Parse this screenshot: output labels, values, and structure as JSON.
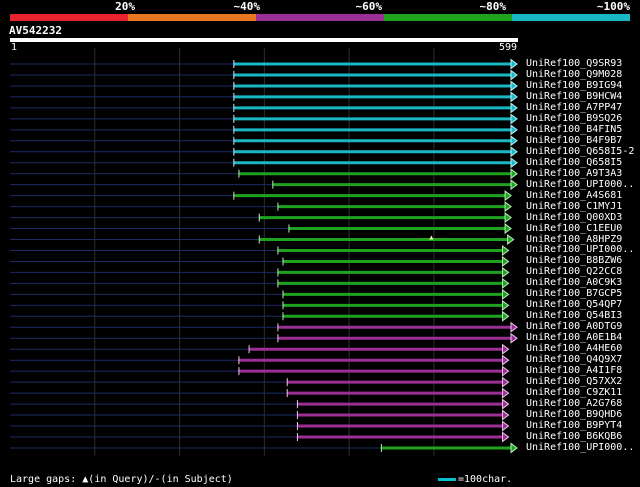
{
  "scale": {
    "segments": [
      {
        "label": "20%",
        "color": "#e8232f"
      },
      {
        "label": "~40%",
        "color": "#e87722"
      },
      {
        "label": "~60%",
        "color": "#9b2f96"
      },
      {
        "label": "~80%",
        "color": "#1fa31f"
      },
      {
        "label": "~100%",
        "color": "#1ab7c4"
      }
    ]
  },
  "query": {
    "name": "AV542232",
    "start": "1",
    "end": "599",
    "length": 599
  },
  "colors": {
    "cyan": "#1ab7c4",
    "green": "#1fa31f",
    "purple": "#9b2f96",
    "dotted": "#1c2a66",
    "gridline": "#2e2e2e",
    "arrow_cyan": "#bdf2f6",
    "arrow_green": "#b8f0b8",
    "arrow_purple": "#f0c6ee"
  },
  "hits": [
    {
      "label": "UniRef100_Q9SR93",
      "color": "cyan",
      "start": 265,
      "end": 599
    },
    {
      "label": "UniRef100_Q9M028",
      "color": "cyan",
      "start": 265,
      "end": 599
    },
    {
      "label": "UniRef100_B9IG94",
      "color": "cyan",
      "start": 265,
      "end": 599
    },
    {
      "label": "UniRef100_B9HCW4",
      "color": "cyan",
      "start": 265,
      "end": 599
    },
    {
      "label": "UniRef100_A7PP47",
      "color": "cyan",
      "start": 265,
      "end": 599
    },
    {
      "label": "UniRef100_B9SQ26",
      "color": "cyan",
      "start": 265,
      "end": 599
    },
    {
      "label": "UniRef100_B4FIN5",
      "color": "cyan",
      "start": 265,
      "end": 599
    },
    {
      "label": "UniRef100_B4F9B7",
      "color": "cyan",
      "start": 265,
      "end": 599
    },
    {
      "label": "UniRef100_Q658I5-2",
      "color": "cyan",
      "start": 265,
      "end": 599
    },
    {
      "label": "UniRef100_Q658I5",
      "color": "cyan",
      "start": 265,
      "end": 599
    },
    {
      "label": "UniRef100_A9T3A3",
      "color": "green",
      "start": 271,
      "end": 599
    },
    {
      "label": "UniRef100_UPI000..",
      "color": "green",
      "start": 311,
      "end": 599
    },
    {
      "label": "UniRef100_A4S681",
      "color": "green",
      "start": 265,
      "end": 592
    },
    {
      "label": "UniRef100_C1MYJ1",
      "color": "green",
      "start": 317,
      "end": 592
    },
    {
      "label": "UniRef100_Q00XD3",
      "color": "green",
      "start": 295,
      "end": 592
    },
    {
      "label": "UniRef100_C1EEU0",
      "color": "green",
      "start": 330,
      "end": 592
    },
    {
      "label": "UniRef100_A8HPZ9",
      "color": "green",
      "start": 295,
      "end": 595,
      "gap_at": 498
    },
    {
      "label": "UniRef100_UPI000..",
      "color": "green",
      "start": 317,
      "end": 589
    },
    {
      "label": "UniRef100_B8BZW6",
      "color": "green",
      "start": 323,
      "end": 589
    },
    {
      "label": "UniRef100_Q22CC8",
      "color": "green",
      "start": 317,
      "end": 589
    },
    {
      "label": "UniRef100_A0C9K3",
      "color": "green",
      "start": 317,
      "end": 589
    },
    {
      "label": "UniRef100_B7GCP5",
      "color": "green",
      "start": 323,
      "end": 589
    },
    {
      "label": "UniRef100_Q54QP7",
      "color": "green",
      "start": 323,
      "end": 589
    },
    {
      "label": "UniRef100_Q54BI3",
      "color": "green",
      "start": 323,
      "end": 589
    },
    {
      "label": "UniRef100_A0DTG9",
      "color": "purple",
      "start": 317,
      "end": 599
    },
    {
      "label": "UniRef100_A0E1B4",
      "color": "purple",
      "start": 317,
      "end": 599
    },
    {
      "label": "UniRef100_A4HE60",
      "color": "purple",
      "start": 283,
      "end": 589
    },
    {
      "label": "UniRef100_Q4Q9X7",
      "color": "purple",
      "start": 271,
      "end": 589
    },
    {
      "label": "UniRef100_A4I1F8",
      "color": "purple",
      "start": 271,
      "end": 589
    },
    {
      "label": "UniRef100_Q57XX2",
      "color": "purple",
      "start": 328,
      "end": 589
    },
    {
      "label": "UniRef100_C9ZK11",
      "color": "purple",
      "start": 328,
      "end": 589
    },
    {
      "label": "UniRef100_A2G768",
      "color": "purple",
      "start": 340,
      "end": 589
    },
    {
      "label": "UniRef100_B9QHD6",
      "color": "purple",
      "start": 340,
      "end": 589
    },
    {
      "label": "UniRef100_B9PYT4",
      "color": "purple",
      "start": 340,
      "end": 589
    },
    {
      "label": "UniRef100_B6KQB6",
      "color": "purple",
      "start": 340,
      "end": 589
    },
    {
      "label": "UniRef100_UPI000..",
      "color": "green",
      "start": 439,
      "end": 599
    }
  ],
  "footer": {
    "gaps_prefix": "Large gaps:",
    "gaps_query": "(in Query)/-",
    "gaps_subject": "(in Subject)",
    "gap_glyph": "▲",
    "legend_text": "=100char."
  }
}
